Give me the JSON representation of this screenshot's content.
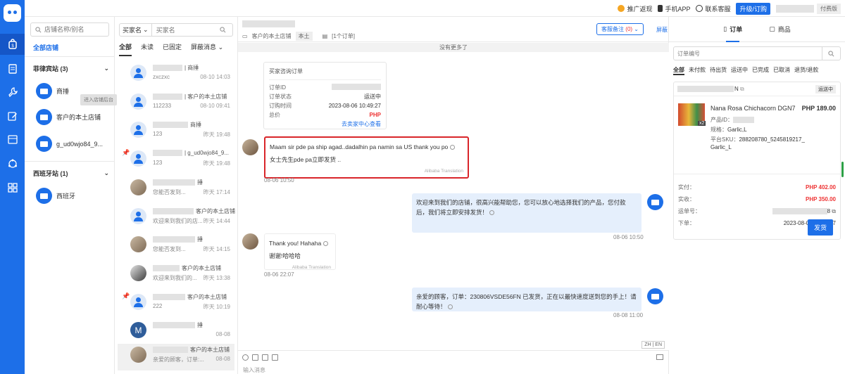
{
  "topbar": {
    "promo": "推广返现",
    "mobile_app": "手机APP",
    "contact": "联系客服",
    "upgrade": "升级/订购",
    "tier": "付费版"
  },
  "stores": {
    "search_placeholder": "店铺名称/别名",
    "all_label": "全部店铺",
    "groups": [
      {
        "name": "菲律宾站 (3)",
        "stores": [
          "商捶",
          "客户的本土店铺",
          "g_ud0wjo84_9..."
        ]
      },
      {
        "name": "西班牙站 (1)",
        "stores": [
          "西班牙"
        ]
      }
    ],
    "tooltip": "进入店铺后台"
  },
  "conversations": {
    "filter_label": "买家名",
    "search_placeholder": "买家名",
    "tabs": [
      "全部",
      "未读",
      "已固定",
      "屏蔽消息"
    ],
    "items": [
      {
        "store": "| 商捶",
        "snippet": "zxczxc",
        "time": "08-10 14:03"
      },
      {
        "store": "| 客户的本土店铺",
        "snippet": "112233",
        "time": "08-10 09:41"
      },
      {
        "store": "商捶",
        "snippet": "123",
        "time": "昨天 19:48"
      },
      {
        "store": "| g_ud0wjo84_9...",
        "snippet": "123",
        "time": "昨天 19:48"
      },
      {
        "store": "捶",
        "snippet": "您能否发到...",
        "time": "昨天 17:14"
      },
      {
        "store": "客户的本土店铺",
        "snippet": "欢迎来到我们的店...",
        "time": "昨天 14:44"
      },
      {
        "store": "捶",
        "snippet": "您能否发到...",
        "time": "昨天 14:15"
      },
      {
        "store": "客户的本土店铺",
        "snippet": "欢迎来到我们的...",
        "time": "昨天 13:38"
      },
      {
        "store": "客户的本土店铺",
        "snippet": "222",
        "time": "昨天 10:19"
      },
      {
        "store": "捶",
        "snippet": "",
        "time": "08-08"
      },
      {
        "store": "客户的本土店铺",
        "snippet": "亲爱的顾客，订单:...",
        "time": "08-08"
      }
    ],
    "avatar_letter": "M"
  },
  "chat": {
    "store_line": "客户的本土店铺",
    "local_tag": "本土",
    "order_count": "[1个订单]",
    "remark_label": "客服备注",
    "remark_count": "(0)",
    "shield": "屏蔽",
    "no_more": "没有更多了",
    "order_card": {
      "title": "买家咨询订单",
      "id_label": "订单ID",
      "status_label": "订单状态",
      "status": "运送中",
      "time_label": "订购时间",
      "time": "2023-08-06 10:49:27",
      "total_label": "总价",
      "total": "PHP",
      "link": "去卖家中心查看"
    },
    "messages": [
      {
        "text": "Maam sir pde pa ship agad..dadalhin pa namin sa US thank you po",
        "translation": "女士先生pde pa立即发货 ..",
        "source": "Alibaba Translation",
        "time": "08-06 10:50"
      },
      {
        "text": "欢迎来到我们的店铺，很高兴能帮助您，您可以放心地选择我们的产品，您付款后，我们将立即安排发货！",
        "time": "08-06 10:50"
      },
      {
        "text": "Thank you! Hahaha",
        "translation": "谢谢!哈哈哈",
        "source": "Alibaba Translation",
        "time": "08-06 22:07"
      },
      {
        "text": "亲爱的顾客，订单：230806VSDE56FN 已发货，正在以最快速度送到您的手上！请耐心等待！",
        "time": "08-08 11:00"
      }
    ],
    "lang_toggle": "ZH | EN",
    "input_placeholder": "输入消息"
  },
  "orders": {
    "tabs": [
      "订单",
      "商品"
    ],
    "search_placeholder": "订单编号",
    "status_tabs": [
      "全部",
      "未付款",
      "待出货",
      "运送中",
      "已完成",
      "已取消",
      "退货/退款"
    ],
    "card": {
      "order_suffix": "N",
      "status": "运送中",
      "product_name": "Nana Rosa Chichacorn DGN7",
      "price": "PHP 189.00",
      "qty": "x2",
      "product_id_label": "产品ID：",
      "spec_label": "规格：",
      "spec": "Garlic,L",
      "sku_label": "平台SKU：",
      "sku": "288208780_5245819217_Garlic_L",
      "paid_label": "实付：",
      "paid": "PHP 402.00",
      "received_label": "实收：",
      "received": "PHP 350.00",
      "tracking_label": "运单号：",
      "tracking_suffix": "8",
      "ordered_label": "下单：",
      "ordered": "2023-08-06 10:49:27",
      "ship_button": "发货"
    }
  },
  "colors": {
    "accent": "#1d6fe8",
    "price_red": "#e33333",
    "highlight_border": "#d9252a"
  }
}
